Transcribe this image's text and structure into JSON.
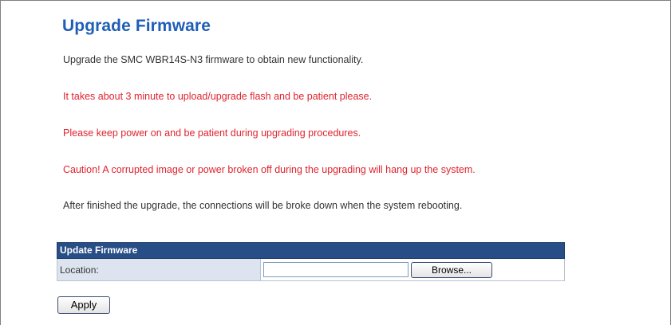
{
  "page": {
    "title": "Upgrade Firmware",
    "paragraphs": {
      "intro": "Upgrade the SMC WBR14S-N3 firmware to obtain new functionality.",
      "time_warning": "It takes about 3 minute to upload/upgrade flash and be patient please.",
      "power_warning": "Please keep power on and be patient during upgrading procedures.",
      "caution": "Caution! A corrupted image or power broken off during the upgrading will hang up the system.",
      "reboot_note": "After finished the upgrade, the connections will be broke down when the system rebooting."
    }
  },
  "firmware_form": {
    "header": "Update Firmware",
    "location_label": "Location:",
    "location_value": "",
    "browse_label": "Browse...",
    "apply_label": "Apply"
  },
  "colors": {
    "title": "#1f5fb7",
    "warning_text": "#e0232f",
    "table_header": "#274e86",
    "label_cell": "#dde4f0"
  }
}
